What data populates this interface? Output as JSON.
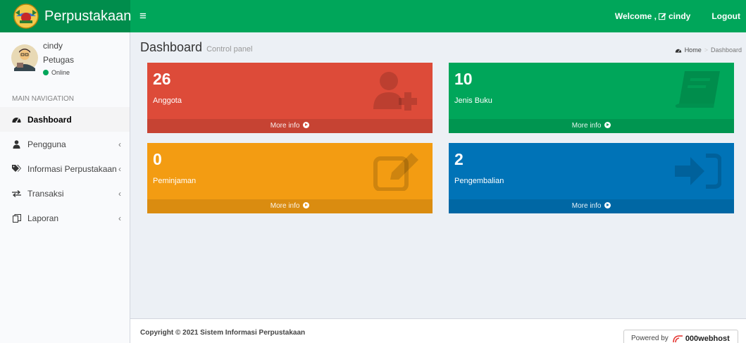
{
  "header": {
    "brand": "Perpustakaan",
    "toggle_icon": "≡",
    "welcome_prefix": "Welcome ,",
    "welcome_user": "cindy",
    "logout_label": "Logout"
  },
  "user": {
    "name": "cindy",
    "role": "Petugas",
    "status": "Online"
  },
  "sidebar": {
    "nav_header": "MAIN NAVIGATION",
    "items": [
      {
        "label": "Dashboard",
        "icon": "dashboard-icon"
      },
      {
        "label": "Pengguna",
        "icon": "user-icon"
      },
      {
        "label": "Informasi Perpustakaan",
        "icon": "tags-icon"
      },
      {
        "label": "Transaksi",
        "icon": "exchange-icon"
      },
      {
        "label": "Laporan",
        "icon": "copy-icon"
      }
    ]
  },
  "content": {
    "title": "Dashboard",
    "subtitle": "Control panel"
  },
  "breadcrumb": {
    "home": "Home",
    "sep": ">",
    "current": "Dashboard"
  },
  "boxes": [
    {
      "value": "26",
      "label": "Anggota",
      "more": "More info",
      "color": "#dd4b39",
      "icon": "user-plus-icon"
    },
    {
      "value": "10",
      "label": "Jenis Buku",
      "more": "More info",
      "color": "#00a65a",
      "icon": "book-icon"
    },
    {
      "value": "0",
      "label": "Peminjaman",
      "more": "More info",
      "color": "#f39c12",
      "icon": "edit-icon"
    },
    {
      "value": "2",
      "label": "Pengembalian",
      "more": "More info",
      "color": "#0073b7",
      "icon": "sign-in-icon"
    }
  ],
  "footer": {
    "copyright": "Copyright © 2021 Sistem Informasi Perpustakaan",
    "powered_by": "Powered by",
    "powered_brand": "000webhost"
  }
}
